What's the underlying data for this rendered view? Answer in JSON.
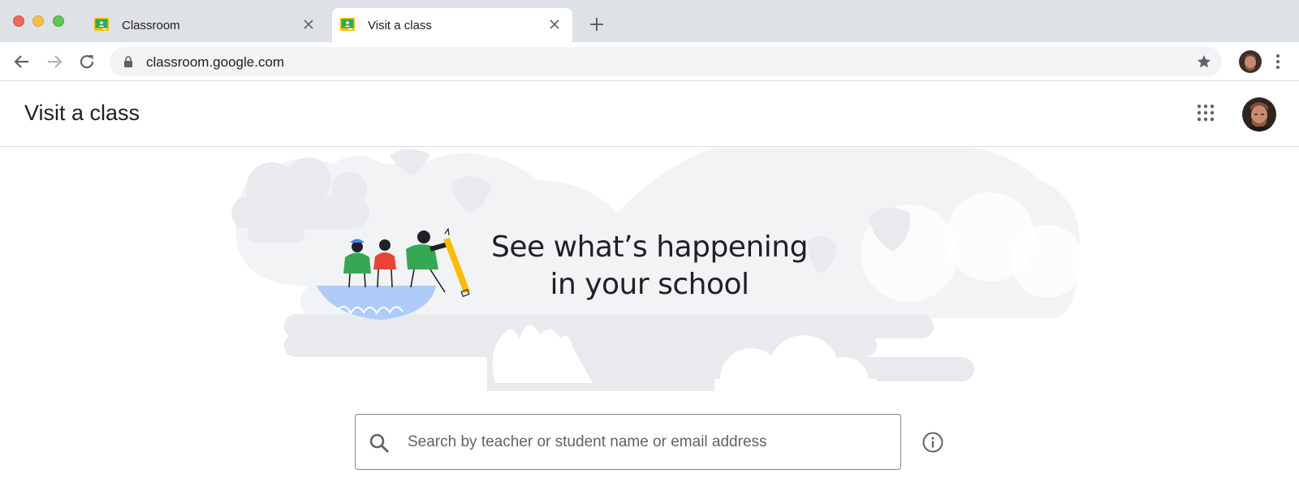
{
  "browser": {
    "tabs": [
      {
        "title": "Classroom",
        "favicon": "classroom-favicon",
        "active": false
      },
      {
        "title": "Visit a class",
        "favicon": "classroom-favicon",
        "active": true
      }
    ],
    "url": "classroom.google.com",
    "icons": {
      "back": "arrow-back-icon",
      "forward": "arrow-forward-icon",
      "reload": "reload-icon",
      "lock": "lock-icon",
      "bookmark": "star-icon",
      "menu": "more-vert-icon",
      "new_tab": "plus-icon"
    }
  },
  "app": {
    "title": "Visit a class",
    "apps_icon": "apps-grid-icon",
    "avatar": "user-avatar"
  },
  "hero": {
    "line1": "See what’s happening",
    "line2": "in your school"
  },
  "search": {
    "placeholder": "Search by teacher or student name or email address",
    "value": "",
    "icon": "search-icon",
    "info_icon": "info-icon"
  },
  "colors": {
    "tabstrip": "#dee1e6",
    "omnibox": "#f1f3f4",
    "hero_cloud": "#f1f3f4",
    "hero_shape": "#e8eaed",
    "boat": "#aecbfa",
    "green": "#34a853",
    "red": "#ea4335",
    "yellow": "#fbbc04",
    "blue": "#4285f4"
  }
}
